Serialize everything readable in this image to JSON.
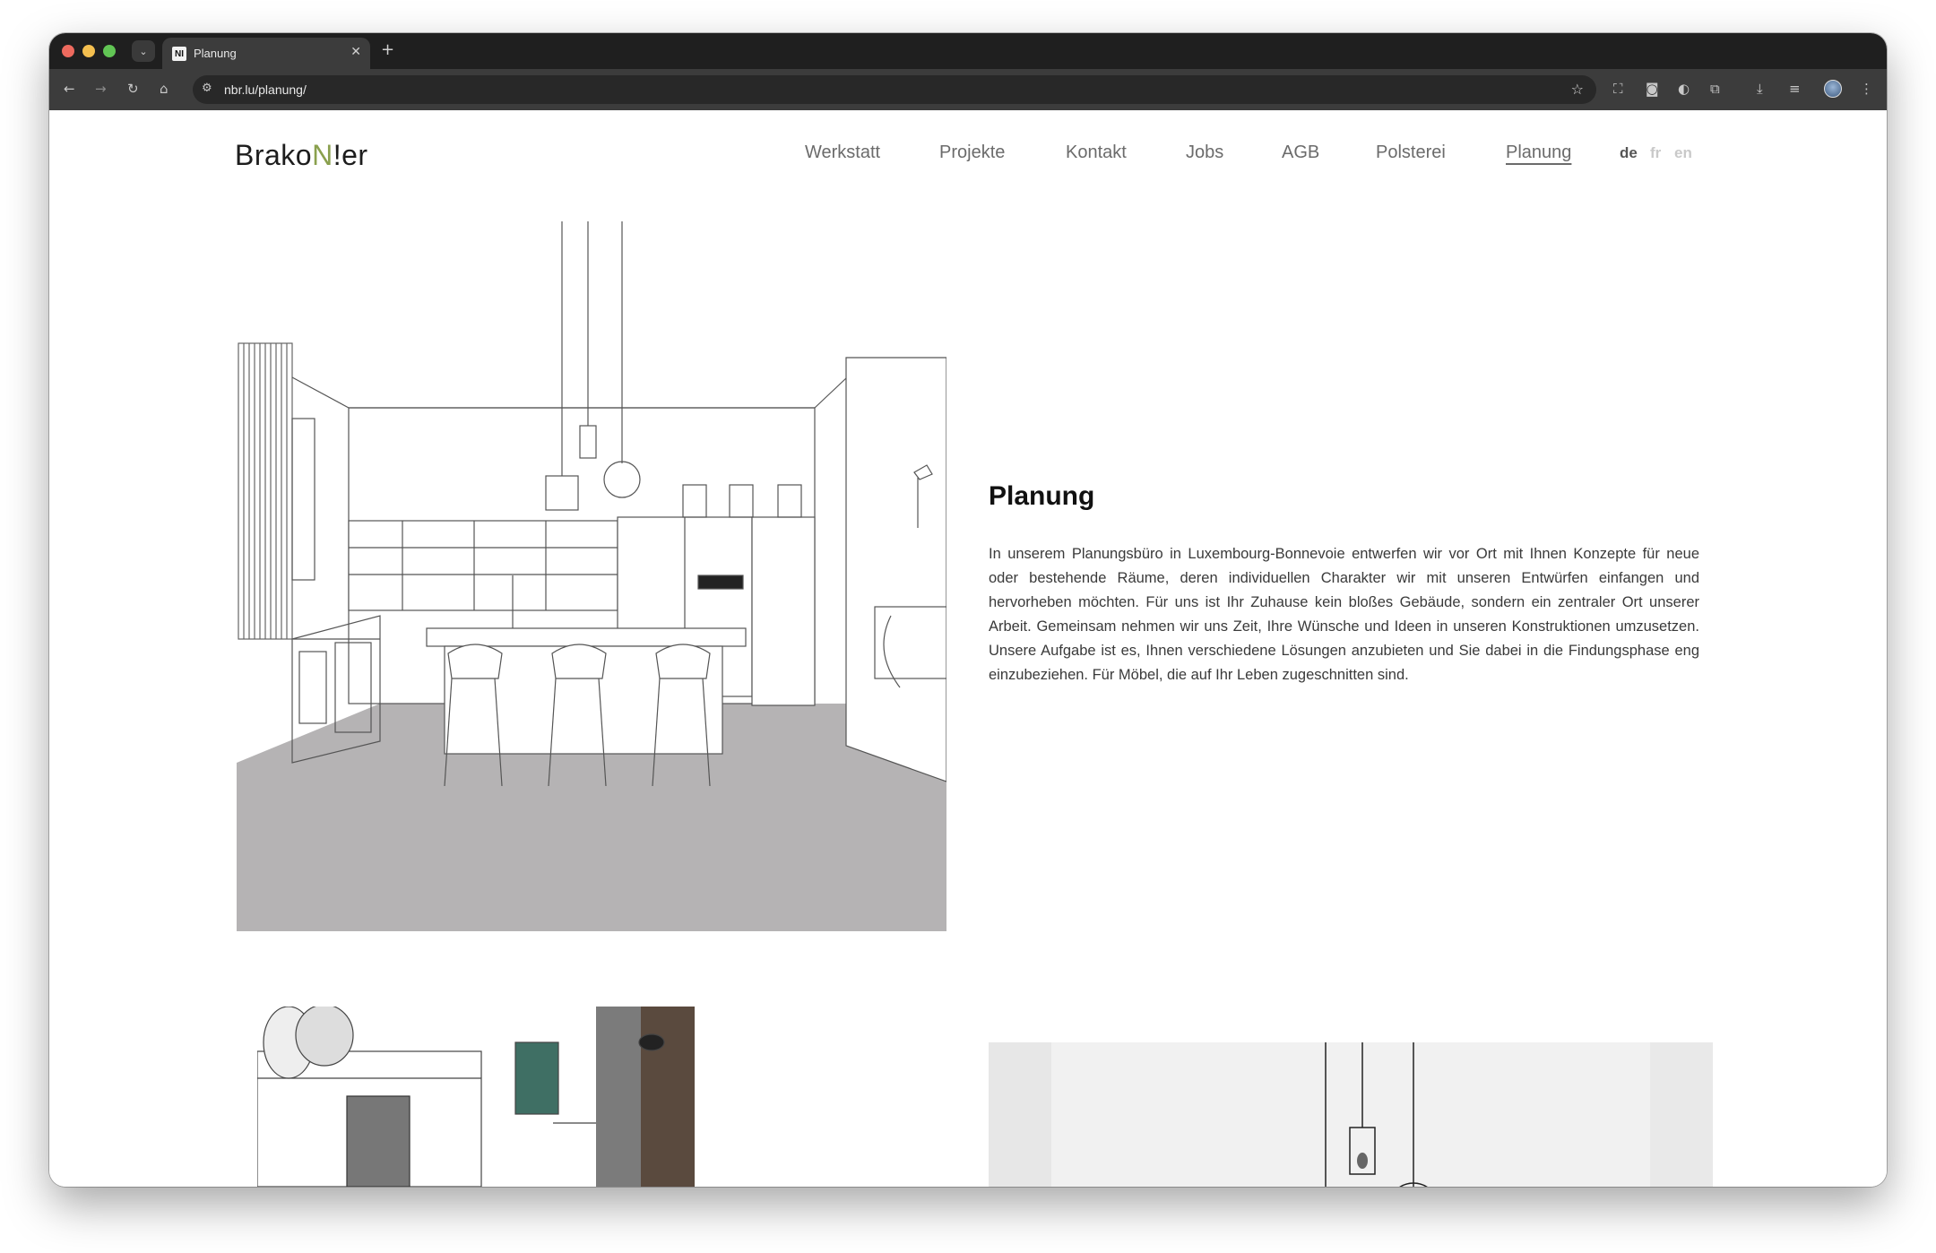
{
  "browser": {
    "tab_title": "Planung",
    "tab_favicon_text": "NI",
    "url": "nbr.lu/planung/",
    "icons": {
      "back": "back-arrow-icon",
      "forward": "forward-arrow-icon",
      "reload": "reload-icon",
      "home": "home-icon",
      "star": "bookmark-star-icon"
    }
  },
  "site": {
    "logo_part1": "Brako",
    "logo_accent": "N",
    "logo_part2": "!er",
    "accent_color": "#8aa04e",
    "nav": [
      {
        "label": "Werkstatt"
      },
      {
        "label": "Projekte"
      },
      {
        "label": "Kontakt"
      },
      {
        "label": "Jobs"
      },
      {
        "label": "AGB"
      },
      {
        "label": "Polsterei"
      },
      {
        "label": "Planung",
        "active": true
      }
    ],
    "languages": [
      {
        "label": "de",
        "active": true
      },
      {
        "label": "fr"
      },
      {
        "label": "en"
      }
    ]
  },
  "content": {
    "heading": "Planung",
    "body": "In unserem Planungsbüro in Luxembourg-Bonnevoie entwerfen wir vor Ort mit Ihnen Konzepte für neue oder bestehende Räume, deren individuellen Charakter wir mit unseren Entwürfen einfangen und hervorheben möchten. Für uns ist Ihr Zuhause kein bloßes Gebäude, sondern ein zentraler Ort unserer Arbeit. Gemeinsam nehmen wir uns Zeit, Ihre Wünsche und Ideen in unseren Konstruktionen umzusetzen. Unsere Aufgabe ist es, Ihnen verschiedene Lösungen anzubieten und Sie dabei in die Findungsphase eng einzubeziehen. Für Möbel, die auf Ihr Leben zugeschnitten sind."
  },
  "consent": {
    "icon": "user-settings-icon",
    "color": "#6c8c46"
  }
}
